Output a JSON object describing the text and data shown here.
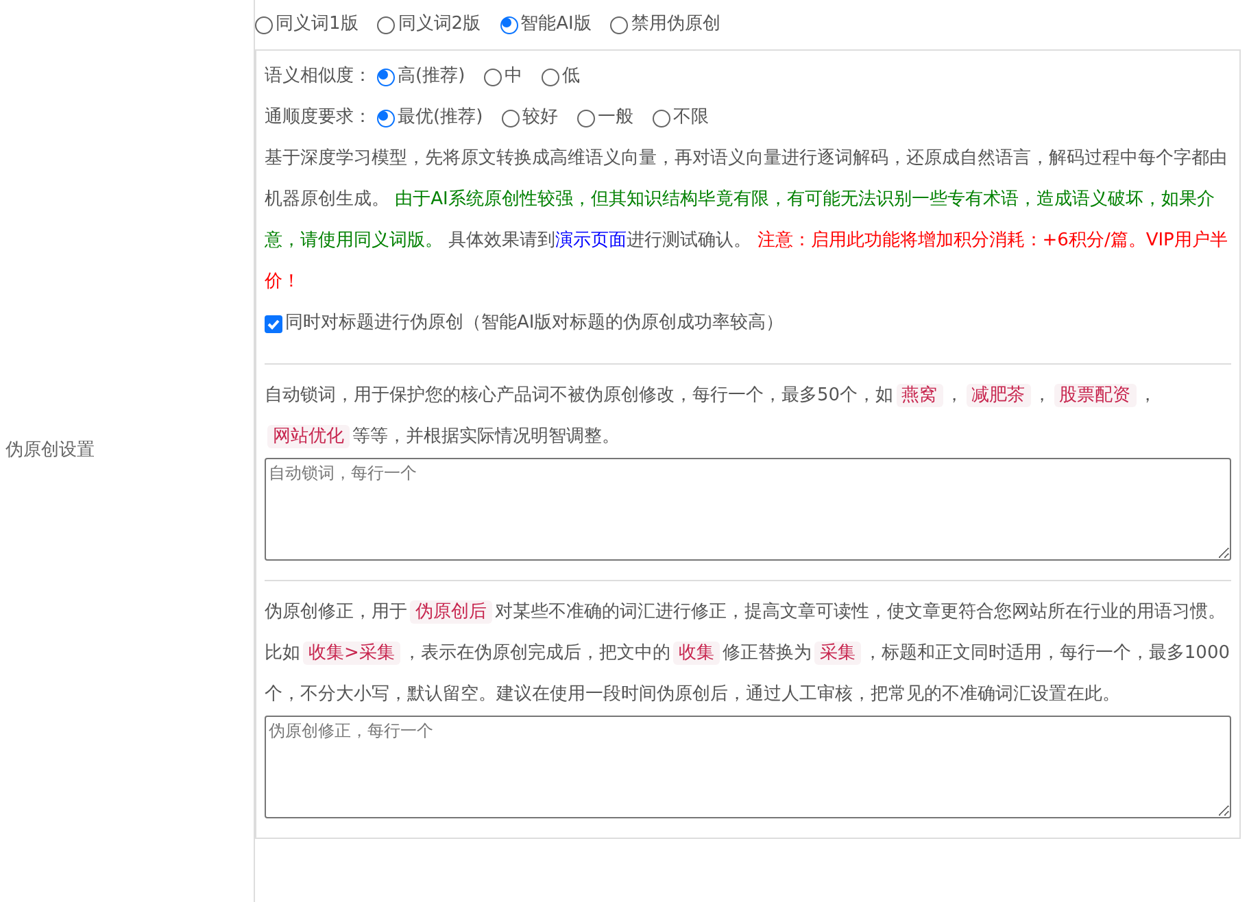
{
  "label": "伪原创设置",
  "modes": [
    {
      "label": "同义词1版",
      "selected": false
    },
    {
      "label": "同义词2版",
      "selected": false
    },
    {
      "label": "智能AI版",
      "selected": true
    },
    {
      "label": "禁用伪原创",
      "selected": false
    }
  ],
  "option_rows": [
    {
      "label": "语义相似度：",
      "options": [
        {
          "label": "高(推荐)",
          "selected": true
        },
        {
          "label": "中",
          "selected": false
        },
        {
          "label": "低",
          "selected": false
        }
      ]
    },
    {
      "label": "通顺度要求：",
      "options": [
        {
          "label": "最优(推荐)",
          "selected": true
        },
        {
          "label": "较好",
          "selected": false
        },
        {
          "label": "一般",
          "selected": false
        },
        {
          "label": "不限",
          "selected": false
        }
      ]
    }
  ],
  "description": [
    {
      "kind": "text",
      "text": "基于深度学习模型，先将原文转换成高维语义向量，再对语义向量进行逐词解码，还原成自然语言，解码过程中每个字都由机器原创生成。 "
    },
    {
      "kind": "success",
      "text": "由于AI系统原创性较强，但其知识结构毕竟有限，有可能无法识别一些专有术语，造成语义破坏，如果介意，请使用同义词版。"
    },
    {
      "kind": "text",
      "text": " 具体效果请到"
    },
    {
      "kind": "link",
      "text": "演示页面"
    },
    {
      "kind": "text",
      "text": "进行测试确认。 "
    },
    {
      "kind": "warning",
      "text": "注意：启用此功能将增加积分消耗：+6积分/篇。VIP用户半价！"
    }
  ],
  "title_option": {
    "label": "同时对标题进行伪原创（智能AI版对标题的伪原创成功率较高）",
    "checked": true
  },
  "sections": [
    {
      "description": [
        {
          "kind": "text",
          "text": "自动锁词，用于保护您的核心产品词不被伪原创修改，每行一个，最多50个，如"
        },
        {
          "kind": "code",
          "text": "燕窝"
        },
        {
          "kind": "text",
          "text": "，"
        },
        {
          "kind": "code",
          "text": "减肥茶"
        },
        {
          "kind": "text",
          "text": "，"
        },
        {
          "kind": "code",
          "text": "股票配资"
        },
        {
          "kind": "text",
          "text": "，"
        },
        {
          "kind": "code",
          "text": "网站优化"
        },
        {
          "kind": "text",
          "text": "等等，并根据实际情况明智调整。"
        }
      ],
      "placeholder": "自动锁词，每行一个"
    },
    {
      "description": [
        {
          "kind": "text",
          "text": "伪原创修正，用于"
        },
        {
          "kind": "code",
          "text": "伪原创后"
        },
        {
          "kind": "text",
          "text": "对某些不准确的词汇进行修正，提高文章可读性，使文章更符合您网站所在行业的用语习惯。比如"
        },
        {
          "kind": "code",
          "text": "收集>采集"
        },
        {
          "kind": "text",
          "text": "，表示在伪原创完成后，把文中的"
        },
        {
          "kind": "code",
          "text": "收集"
        },
        {
          "kind": "text",
          "text": "修正替换为"
        },
        {
          "kind": "code",
          "text": "采集"
        },
        {
          "kind": "text",
          "text": "，标题和正文同时适用，每行一个，最多1000个，不分大小写，默认留空。建议在使用一段时间伪原创后，通过人工审核，把常见的不准确词汇设置在此。"
        }
      ],
      "placeholder": "伪原创修正，每行一个"
    }
  ]
}
